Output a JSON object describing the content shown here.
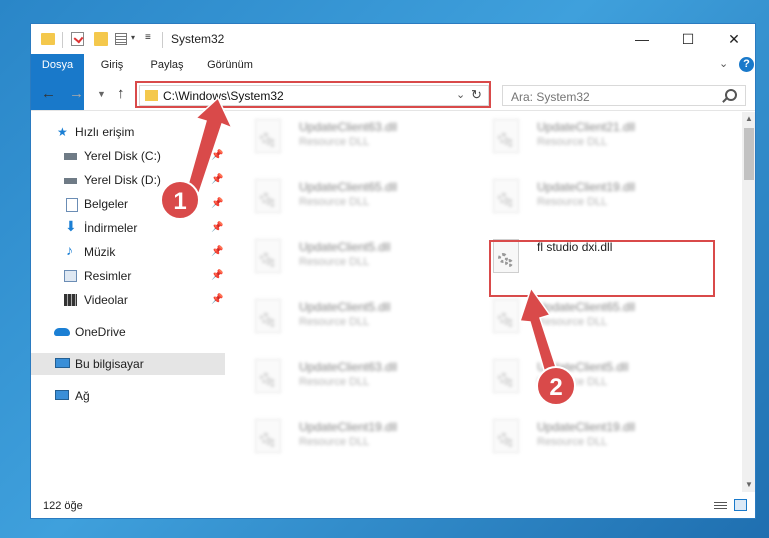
{
  "window": {
    "title": "System32"
  },
  "window_controls": {
    "minimize": "—",
    "maximize": "☐",
    "close": "✕"
  },
  "ribbon": {
    "tabs": [
      "Dosya",
      "Giriş",
      "Paylaş",
      "Görünüm"
    ]
  },
  "address_bar": {
    "path": "C:\\Windows\\System32"
  },
  "search": {
    "placeholder": "Ara: System32"
  },
  "sidebar": {
    "items": [
      {
        "label": "Hızlı erişim"
      },
      {
        "label": "Yerel Disk (C:)"
      },
      {
        "label": "Yerel Disk (D:)"
      },
      {
        "label": "Belgeler"
      },
      {
        "label": "İndirmeler"
      },
      {
        "label": "Müzik"
      },
      {
        "label": "Resimler"
      },
      {
        "label": "Videolar"
      },
      {
        "label": "OneDrive"
      },
      {
        "label": "Bu bilgisayar"
      },
      {
        "label": "Ağ"
      }
    ]
  },
  "files": [
    {
      "name": "UpdateClient63.dll",
      "type": "Resource DLL"
    },
    {
      "name": "UpdateClient21.dll",
      "type": "Resource DLL"
    },
    {
      "name": "UpdateClient65.dll",
      "type": "Resource DLL"
    },
    {
      "name": "UpdateClient19.dll",
      "type": "Resource DLL"
    },
    {
      "name": "UpdateClient5.dll",
      "type": "Resource DLL"
    },
    {
      "name": "fl studio dxi.dll",
      "type": ""
    },
    {
      "name": "UpdateClient5.dll",
      "type": "Resource DLL"
    },
    {
      "name": "UpdateClient65.dll",
      "type": "Resource DLL"
    },
    {
      "name": "UpdateClient63.dll",
      "type": "Resource DLL"
    },
    {
      "name": "UpdateClient5.dll",
      "type": "Resource DLL"
    },
    {
      "name": "UpdateClient19.dll",
      "type": "Resource DLL"
    },
    {
      "name": "UpdateClient19.dll",
      "type": "Resource DLL"
    }
  ],
  "status": {
    "item_count": "122 öğe"
  },
  "callouts": {
    "one": "1",
    "two": "2"
  },
  "colors": {
    "accent": "#1979ca",
    "highlight": "#d94a4a"
  }
}
